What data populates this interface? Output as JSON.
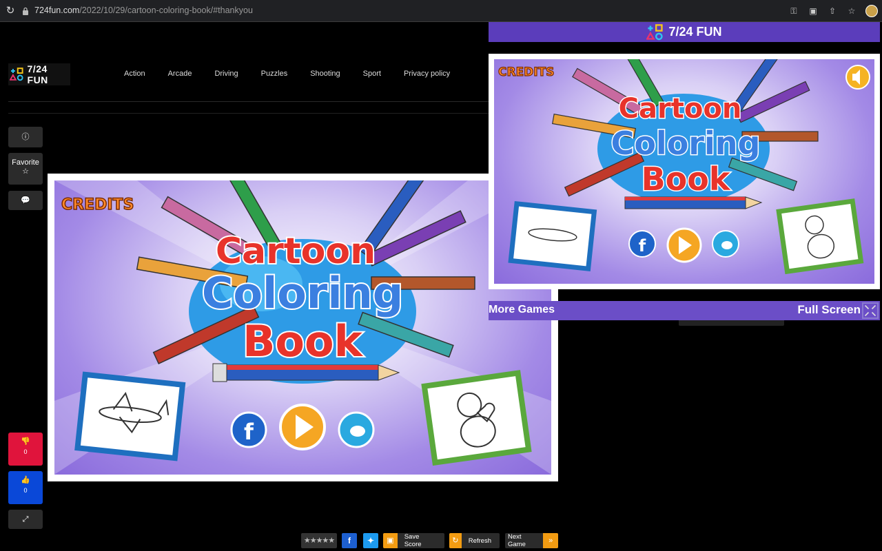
{
  "browser": {
    "url_host": "724fun.com",
    "url_path": "/2022/10/29/cartoon-coloring-book/#thankyou"
  },
  "site": {
    "logo_text": "7/24 FUN",
    "nav": [
      "Action",
      "Arcade",
      "Driving",
      "Puzzles",
      "Shooting",
      "Sport",
      "Privacy policy"
    ]
  },
  "sidebar": {
    "favorite_label": "Favorite",
    "dislike_count": "0",
    "like_count": "0"
  },
  "game": {
    "credits_label": "CREDITS",
    "title_line1": "Cartoon",
    "title_line2": "Coloring",
    "title_line3": "Book"
  },
  "popup": {
    "header_title": "7/24 FUN",
    "more_games_label": "More Games",
    "full_screen_label": "Full Screen"
  },
  "toolbar": {
    "save_score_label": "Save Score",
    "refresh_label": "Refresh",
    "next_game_label": "Next Game"
  },
  "colors": {
    "accent_orange": "#f39c12",
    "like_blue": "#0a48d8",
    "dislike_red": "#e0143c",
    "popup_purple": "#5b3dbb"
  }
}
